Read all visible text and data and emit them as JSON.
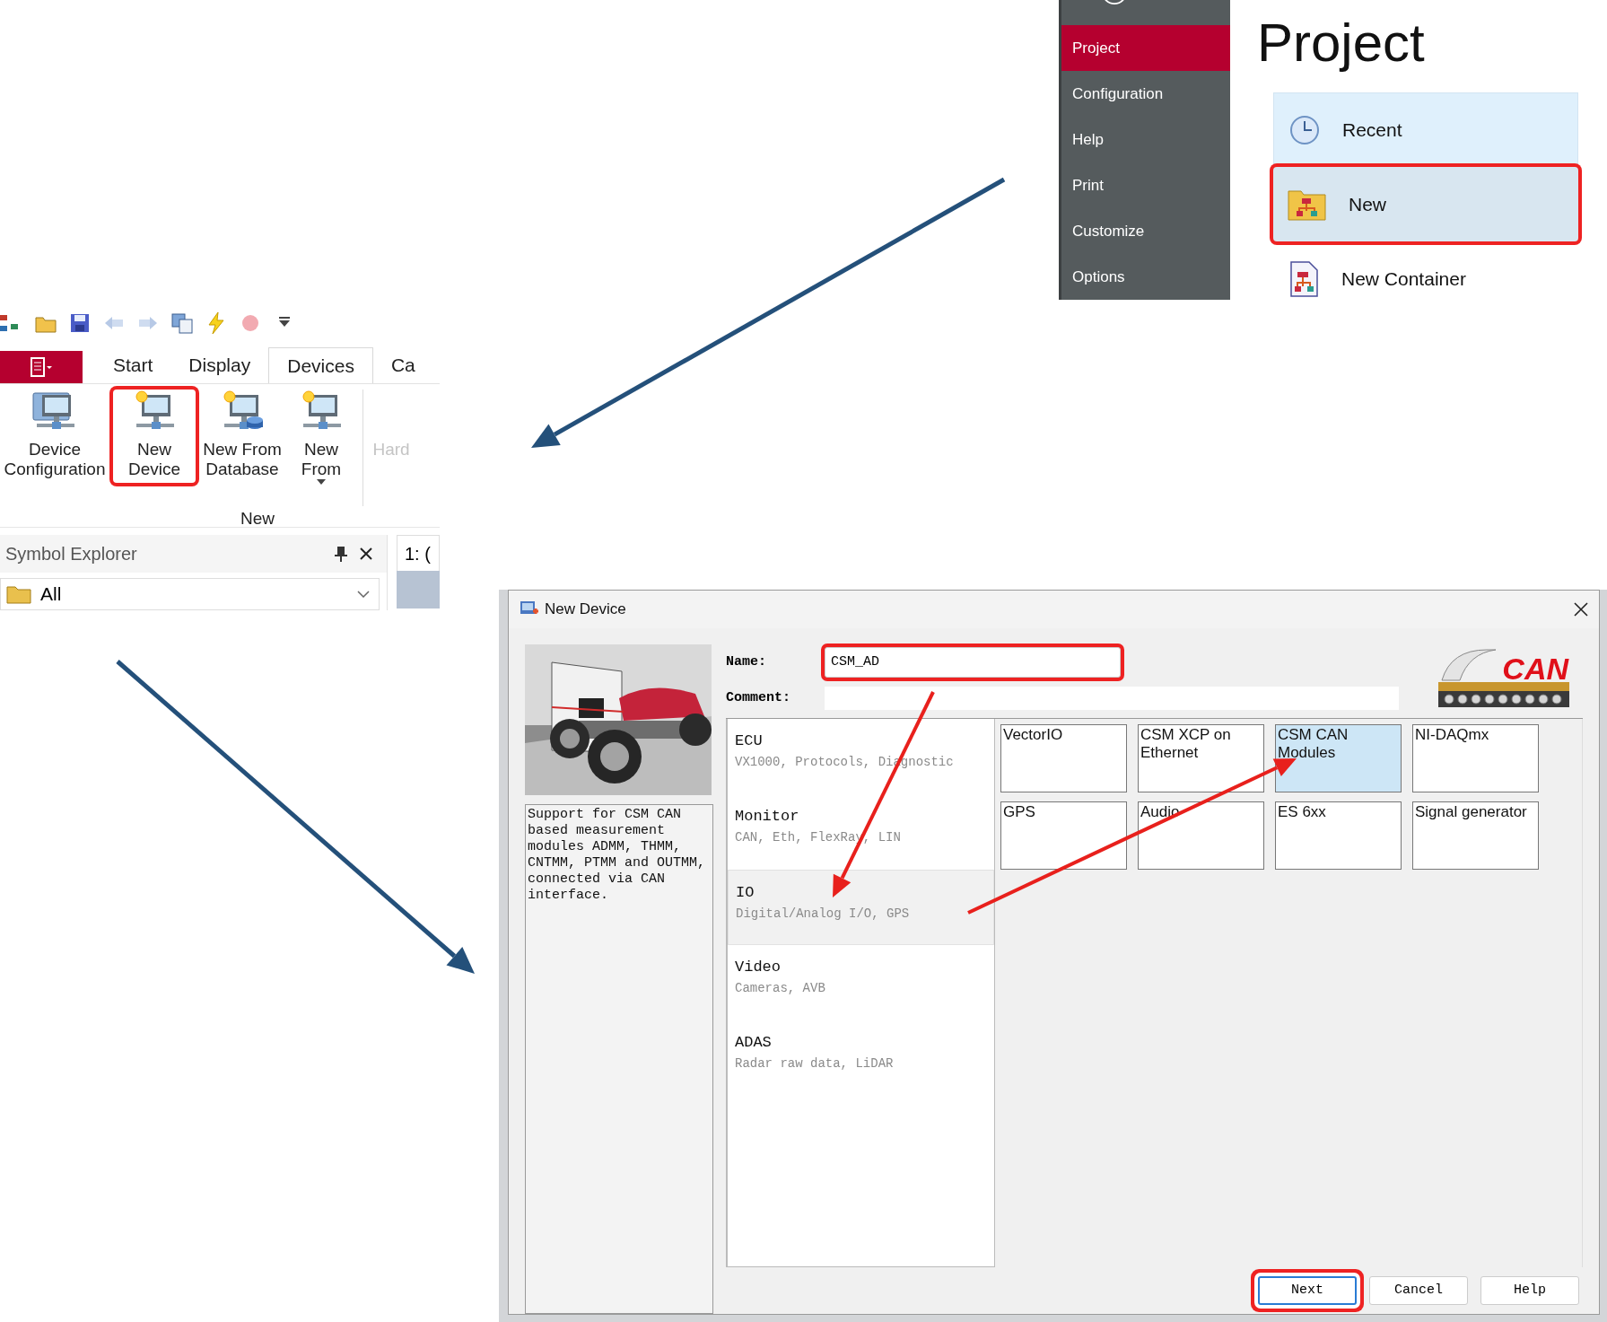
{
  "ribbon": {
    "tabs": [
      {
        "label": "Start",
        "selected": false
      },
      {
        "label": "Display",
        "selected": false
      },
      {
        "label": "Devices",
        "selected": true
      },
      {
        "label": "Ca",
        "selected": false
      }
    ],
    "buttons": [
      {
        "label": "Device Configuration",
        "kind": "config",
        "disabled": false,
        "dropdown": false,
        "highlighted": false
      },
      {
        "label": "New Device",
        "kind": "new",
        "disabled": false,
        "dropdown": false,
        "highlighted": true
      },
      {
        "label": "New From Database",
        "kind": "database",
        "disabled": false,
        "dropdown": false,
        "highlighted": false
      },
      {
        "label": "New From",
        "kind": "from",
        "disabled": false,
        "dropdown": true,
        "highlighted": false
      },
      {
        "label": "Hard",
        "kind": "text",
        "disabled": true,
        "dropdown": false,
        "highlighted": false
      }
    ],
    "group_label": "New"
  },
  "symbol_explorer": {
    "title": "Symbol Explorer",
    "filter": "All"
  },
  "document_tab": "1: (",
  "backstage": {
    "nav": [
      {
        "label": "Project",
        "selected": true
      },
      {
        "label": "Configuration",
        "selected": false
      },
      {
        "label": "Help",
        "selected": false
      },
      {
        "label": "Print",
        "selected": false
      },
      {
        "label": "Customize",
        "selected": false
      },
      {
        "label": "Options",
        "selected": false
      }
    ],
    "heading": "Project",
    "commands": [
      {
        "label": "Recent",
        "kind": "recent",
        "hovered": true,
        "selected": false
      },
      {
        "label": "New",
        "kind": "new",
        "hovered": false,
        "selected": true
      },
      {
        "label": "New Container",
        "kind": "container",
        "hovered": false,
        "selected": false
      }
    ]
  },
  "dialog": {
    "title": "New Device",
    "description": "Support for CSM CAN based measurement modules ADMM, THMM, CNTMM, PTMM and OUTMM, connected via CAN interface.",
    "name_label": "Name:",
    "name_value": "CSM_AD",
    "comment_label": "Comment:",
    "logo_text": "CAN",
    "categories": [
      {
        "title": "ECU",
        "subtitle": "VX1000, Protocols, Diagnostic",
        "selected": false
      },
      {
        "title": "Monitor",
        "subtitle": "CAN, Eth, FlexRay, LIN",
        "selected": false
      },
      {
        "title": "IO",
        "subtitle": "Digital/Analog I/O, GPS",
        "selected": true
      },
      {
        "title": "Video",
        "subtitle": "Cameras, AVB",
        "selected": false
      },
      {
        "title": "ADAS",
        "subtitle": "Radar raw data, LiDAR",
        "selected": false
      }
    ],
    "tiles": [
      {
        "label": "VectorIO",
        "selected": false
      },
      {
        "label": "CSM XCP on Ethernet",
        "selected": false
      },
      {
        "label": "CSM CAN Modules",
        "selected": true
      },
      {
        "label": "NI-DAQmx",
        "selected": false
      },
      {
        "label": "GPS",
        "selected": false
      },
      {
        "label": "Audio",
        "selected": false
      },
      {
        "label": "ES 6xx",
        "selected": false
      },
      {
        "label": "Signal generator",
        "selected": false
      }
    ],
    "buttons": [
      {
        "label": "Next",
        "default": true
      },
      {
        "label": "Cancel",
        "default": false
      },
      {
        "label": "Help",
        "default": false
      }
    ]
  }
}
